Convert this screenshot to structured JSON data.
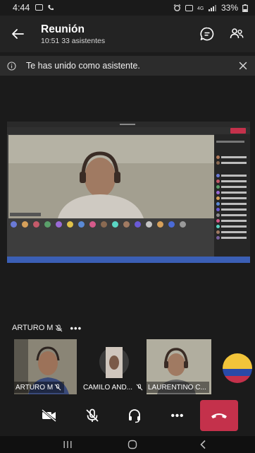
{
  "status": {
    "time": "4:44",
    "battery": "33%"
  },
  "header": {
    "title": "Reunión",
    "time": "10:51",
    "attendees": "33 asistentes",
    "icons": [
      "back-arrow-icon",
      "chat-icon",
      "participants-icon"
    ]
  },
  "banner": {
    "text": "Te has unido como asistente.",
    "icons": [
      "info-icon",
      "close-icon"
    ]
  },
  "speaker": {
    "label": "ARTURO M",
    "more": "•••"
  },
  "tiles": [
    {
      "label": "ARTURO M",
      "muted": true
    },
    {
      "label": "CAMILO AND...",
      "muted": true
    },
    {
      "label": "LAURENTINO C...",
      "muted": false
    }
  ],
  "controls": {
    "icons": [
      "camera-off-icon",
      "mic-off-icon",
      "headset-icon",
      "more-icon",
      "hang-up-icon"
    ],
    "more": "•••"
  },
  "colors": {
    "background": "#1b1b1b",
    "app_bar": "#232323",
    "banner": "#2c2c2c",
    "hangup": "#c4314b"
  }
}
